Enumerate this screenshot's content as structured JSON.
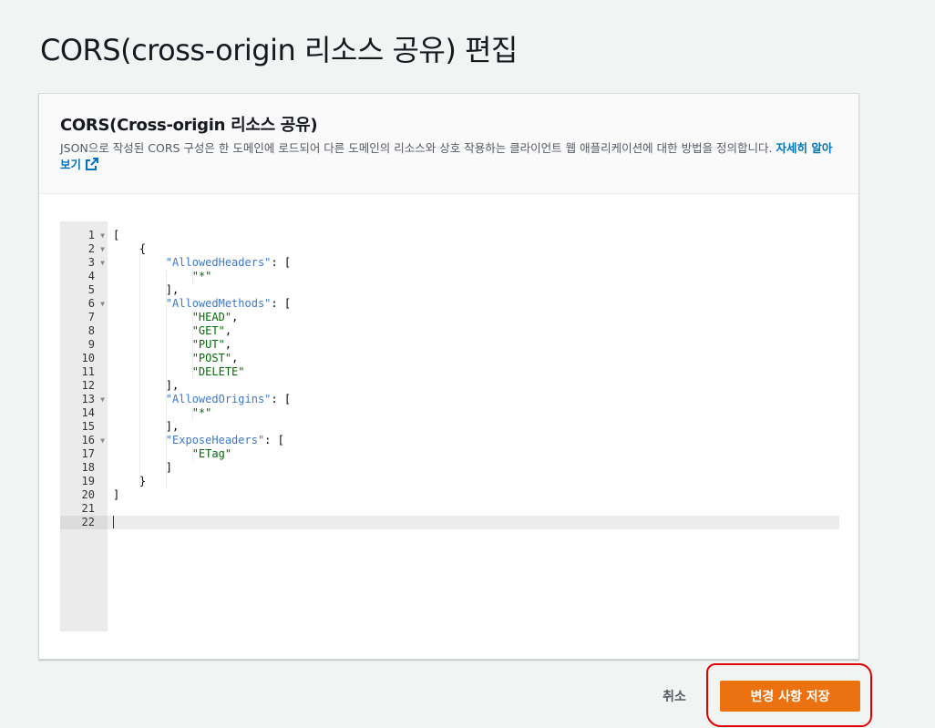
{
  "page": {
    "title": "CORS(cross-origin 리소스 공유) 편집"
  },
  "panel": {
    "title": "CORS(Cross-origin 리소스 공유)",
    "description": "JSON으로 작성된 CORS 구성은 한 도메인에 로드되어 다른 도메인의 리소스와 상호 작용하는 클라이언트 웹 애플리케이션에 대한 방법을 정의합니다.",
    "learn_more": "자세히 알아보기",
    "learn_more_icon": "external-link-icon"
  },
  "editor": {
    "active_line": 22,
    "lines": [
      {
        "n": "1",
        "fold": true,
        "text": "["
      },
      {
        "n": "2",
        "fold": true,
        "text": "    {"
      },
      {
        "n": "3",
        "fold": true,
        "text": "        \"AllowedHeaders\": ["
      },
      {
        "n": "4",
        "fold": false,
        "text": "            \"*\""
      },
      {
        "n": "5",
        "fold": false,
        "text": "        ],"
      },
      {
        "n": "6",
        "fold": true,
        "text": "        \"AllowedMethods\": ["
      },
      {
        "n": "7",
        "fold": false,
        "text": "            \"HEAD\","
      },
      {
        "n": "8",
        "fold": false,
        "text": "            \"GET\","
      },
      {
        "n": "9",
        "fold": false,
        "text": "            \"PUT\","
      },
      {
        "n": "10",
        "fold": false,
        "text": "            \"POST\","
      },
      {
        "n": "11",
        "fold": false,
        "text": "            \"DELETE\""
      },
      {
        "n": "12",
        "fold": false,
        "text": "        ],"
      },
      {
        "n": "13",
        "fold": true,
        "text": "        \"AllowedOrigins\": ["
      },
      {
        "n": "14",
        "fold": false,
        "text": "            \"*\""
      },
      {
        "n": "15",
        "fold": false,
        "text": "        ],"
      },
      {
        "n": "16",
        "fold": true,
        "text": "        \"ExposeHeaders\": ["
      },
      {
        "n": "17",
        "fold": false,
        "text": "            \"ETag\""
      },
      {
        "n": "18",
        "fold": false,
        "text": "        ]"
      },
      {
        "n": "19",
        "fold": false,
        "text": "    }"
      },
      {
        "n": "20",
        "fold": false,
        "text": "]"
      },
      {
        "n": "21",
        "fold": false,
        "text": ""
      },
      {
        "n": "22",
        "fold": false,
        "text": ""
      }
    ]
  },
  "actions": {
    "cancel_label": "취소",
    "save_label": "변경 사항 저장"
  },
  "colors": {
    "primary_button": "#ec7211",
    "link": "#0073bb",
    "json_key": "#3e78c9",
    "json_string": "#036a07",
    "annotation": "#e10000"
  }
}
